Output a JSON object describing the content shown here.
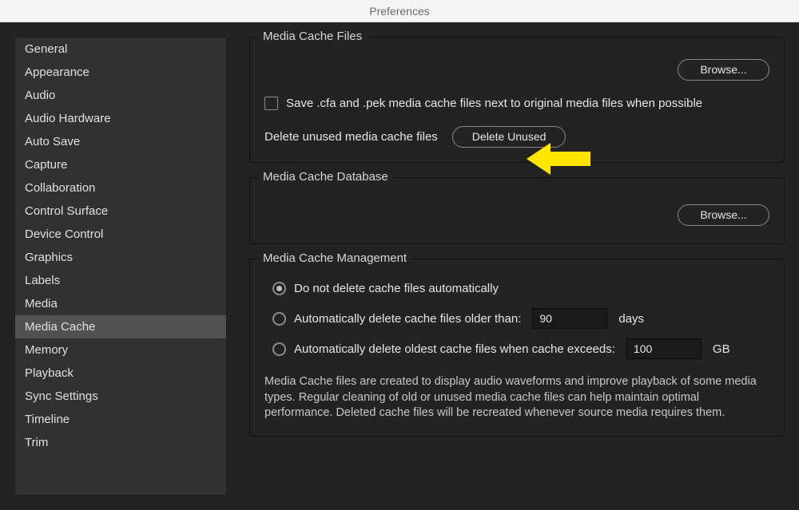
{
  "title": "Preferences",
  "sidebar": {
    "items": [
      {
        "label": "General"
      },
      {
        "label": "Appearance"
      },
      {
        "label": "Audio"
      },
      {
        "label": "Audio Hardware"
      },
      {
        "label": "Auto Save"
      },
      {
        "label": "Capture"
      },
      {
        "label": "Collaboration"
      },
      {
        "label": "Control Surface"
      },
      {
        "label": "Device Control"
      },
      {
        "label": "Graphics"
      },
      {
        "label": "Labels"
      },
      {
        "label": "Media"
      },
      {
        "label": "Media Cache"
      },
      {
        "label": "Memory"
      },
      {
        "label": "Playback"
      },
      {
        "label": "Sync Settings"
      },
      {
        "label": "Timeline"
      },
      {
        "label": "Trim"
      }
    ],
    "selected_index": 12
  },
  "group_files": {
    "title": "Media Cache Files",
    "browse_label": "Browse...",
    "save_next_to_label": "Save .cfa and .pek media cache files next to original media files when possible",
    "delete_row_label": "Delete unused media cache files",
    "delete_button_label": "Delete Unused"
  },
  "group_db": {
    "title": "Media Cache Database",
    "browse_label": "Browse..."
  },
  "group_mgmt": {
    "title": "Media Cache Management",
    "opt_none": "Do not delete cache files automatically",
    "opt_older": "Automatically delete cache files older than:",
    "opt_older_value": "90",
    "opt_older_unit": "days",
    "opt_exceeds": "Automatically delete oldest cache files when cache exceeds:",
    "opt_exceeds_value": "100",
    "opt_exceeds_unit": "GB",
    "selected": "none",
    "help": "Media Cache files are created to display audio waveforms and improve playback of some media types.  Regular cleaning of old or unused media cache files can help maintain optimal performance. Deleted cache files will be recreated whenever source media requires them."
  },
  "annotation_arrow_color": "#ffe600"
}
